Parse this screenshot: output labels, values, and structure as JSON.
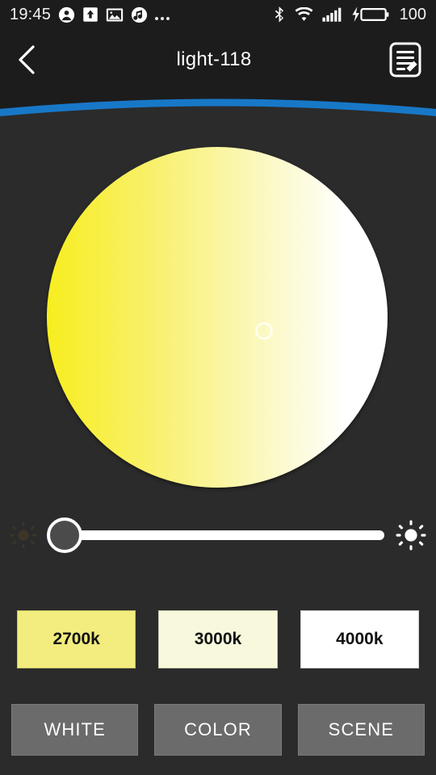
{
  "status_bar": {
    "time": "19:45",
    "battery_percent": "100",
    "left_icons": [
      {
        "name": "contact-icon",
        "glyph": "person-in-circle"
      },
      {
        "name": "upload-icon",
        "glyph": "square-up-arrow"
      },
      {
        "name": "image-icon",
        "glyph": "photo"
      },
      {
        "name": "music-icon",
        "glyph": "music-note"
      },
      {
        "name": "more-icon",
        "glyph": "ellipsis"
      }
    ],
    "right_icons": [
      {
        "name": "bluetooth-icon",
        "glyph": "bluetooth"
      },
      {
        "name": "wifi-icon",
        "glyph": "wifi"
      },
      {
        "name": "signal-icon",
        "glyph": "signal-bars"
      },
      {
        "name": "charging-battery-icon",
        "glyph": "bolt-battery"
      }
    ]
  },
  "titlebar": {
    "back_label": "back",
    "title": "light-118",
    "edit_label": "edit"
  },
  "colors": {
    "background": "#2b2b2b",
    "bar_background": "#1c1c1c",
    "accent_blue": "#1878c8",
    "wheel_warm": "#f7ee1f",
    "wheel_cool": "#ffffff",
    "slider_track": "#ffffff",
    "slider_thumb": "#4b4b4b",
    "mode_button": "#6b6b6b"
  },
  "wheel": {
    "label": "color-temperature-wheel",
    "handle_label": "temperature-handle"
  },
  "brightness": {
    "low_icon": "sun-dim-icon",
    "high_icon": "sun-bright-icon",
    "value": "0"
  },
  "presets": [
    {
      "label": "2700k",
      "color": "#f2ed7e"
    },
    {
      "label": "3000k",
      "color": "#f8f8dc"
    },
    {
      "label": "4000k",
      "color": "#ffffff"
    }
  ],
  "modes": [
    {
      "label": "WHITE"
    },
    {
      "label": "COLOR"
    },
    {
      "label": "SCENE"
    }
  ]
}
